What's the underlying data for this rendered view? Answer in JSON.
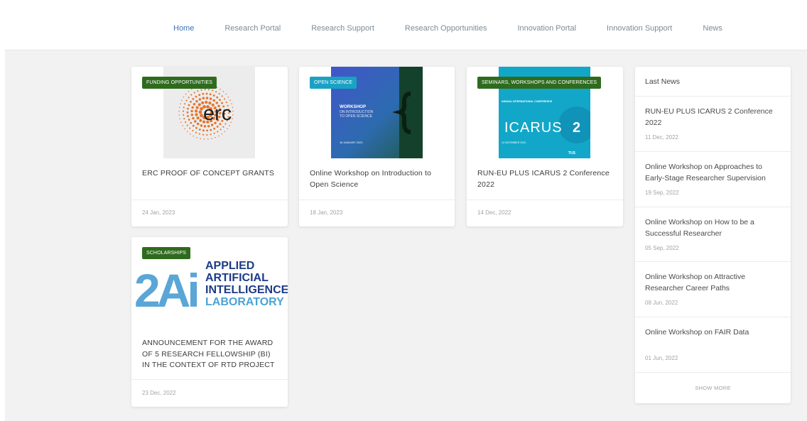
{
  "nav": {
    "items": [
      {
        "label": "Home",
        "active": true
      },
      {
        "label": "Research Portal"
      },
      {
        "label": "Research Support"
      },
      {
        "label": "Research Opportunities"
      },
      {
        "label": "Innovation Portal"
      },
      {
        "label": "Innovation Support"
      },
      {
        "label": "News"
      }
    ]
  },
  "cards": [
    {
      "tag": "FUNDING OPPORTUNITIES",
      "tag_color": "#2e6b1e",
      "image": "erc-logo",
      "title": "ERC PROOF OF CONCEPT GRANTS",
      "date": "24 Jan, 2023"
    },
    {
      "tag": "OPEN SCIENCE",
      "tag_color": "#1aa2c4",
      "image": "workshop-poster",
      "image_text": {
        "head": "WORKSHOP",
        "sub1": "ON INTRODUCTION",
        "sub2": "TO OPEN SCIENCE",
        "date": "18 JANUARY 2023"
      },
      "title": "Online Workshop on Introduction to Open Science",
      "date": "18 Jan, 2023"
    },
    {
      "tag": "SEMINARS, WORKSHOPS AND CONFERENCES",
      "tag_color": "#2e6b1e",
      "image": "icarus-poster",
      "image_text": {
        "conf": "ANNUAL INTERNATIONAL CONFERENCE",
        "word": "ICARUS",
        "num": "2",
        "date": "14 DECEMBER 2022",
        "brand": "TUS"
      },
      "title": "RUN-EU PLUS ICARUS 2 Conference 2022",
      "date": "14 Dec, 2022"
    },
    {
      "tag": "SCHOLARSHIPS",
      "tag_color": "#2e6b1e",
      "image": "2ai-logo",
      "image_text": {
        "mark": "2Ai",
        "l1": "APPLIED",
        "l2": "ARTIFICIAL",
        "l3": "INTELLIGENCE",
        "l4": "LABORATORY"
      },
      "title": "ANNOUNCEMENT FOR THE AWARD OF 5 RESEARCH FELLOWSHIP (BI) IN THE CONTEXT OF RTD PROJECT",
      "date": "23 Dec, 2022"
    }
  ],
  "sidebar": {
    "title": "Last News",
    "items": [
      {
        "title": "RUN-EU PLUS ICARUS 2 Conference 2022",
        "date": "11 Dec, 2022"
      },
      {
        "title": "Online Workshop on Approaches to Early-Stage Researcher Supervision",
        "date": "19 Sep, 2022"
      },
      {
        "title": "Online Workshop on How to be a Successful Researcher",
        "date": "05 Sep, 2022"
      },
      {
        "title": "Online Workshop on Attractive Researcher Career Paths",
        "date": "08 Jun, 2022"
      },
      {
        "title": "Online Workshop on FAIR Data",
        "date": "01 Jun, 2022"
      }
    ],
    "show_more": "SHOW MORE"
  }
}
